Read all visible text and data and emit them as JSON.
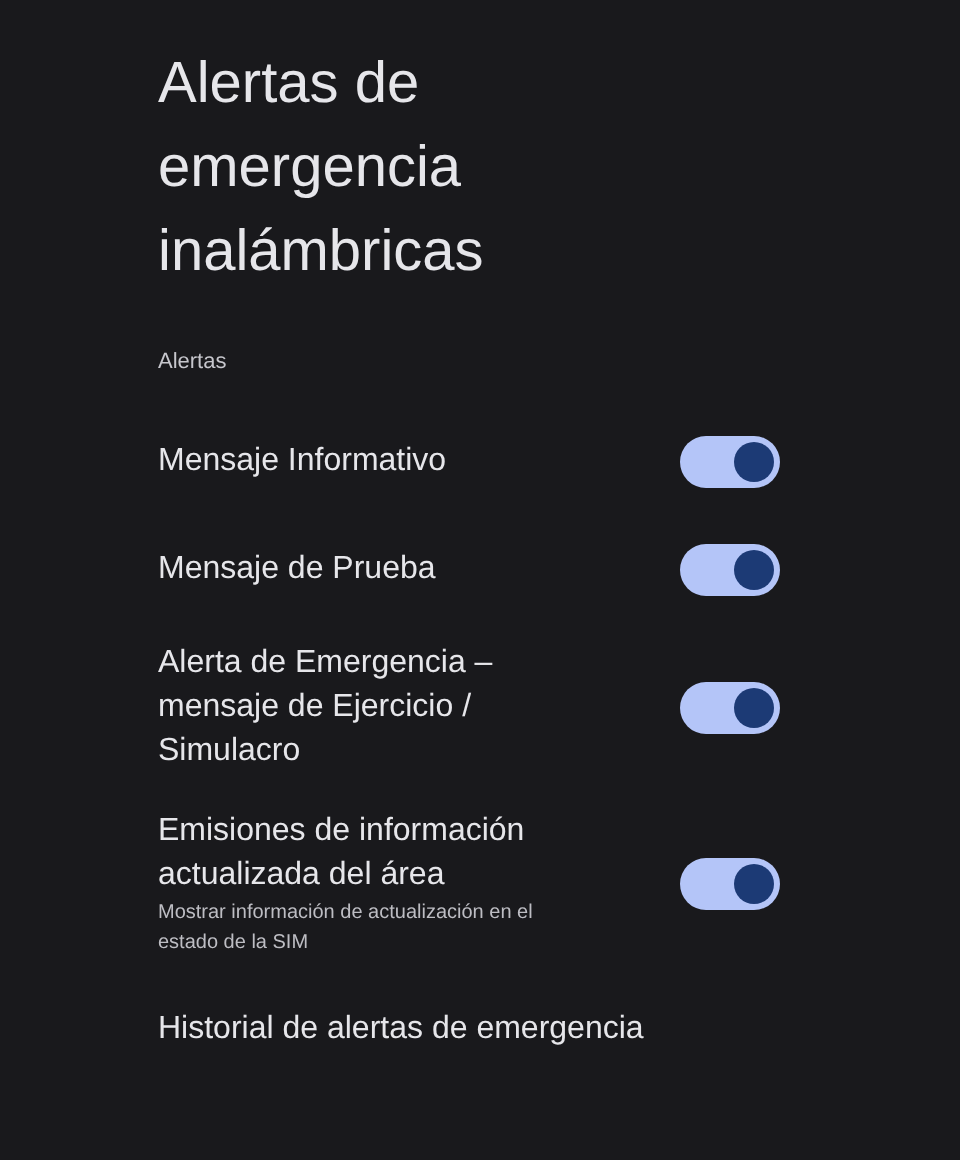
{
  "title": "Alertas de emergencia inalámbricas",
  "section": {
    "header": "Alertas",
    "items": [
      {
        "kind": "toggle",
        "label": "Mensaje Informativo",
        "on": true
      },
      {
        "kind": "toggle",
        "label": "Mensaje de Prueba",
        "on": true
      },
      {
        "kind": "toggle",
        "label": "Alerta de Emergencia – mensaje de Ejercicio / Simulacro",
        "on": true
      },
      {
        "kind": "toggle",
        "label": "Emisiones de información actualizada del área",
        "summary": "Mostrar información de actualización en el estado de la SIM",
        "on": true
      },
      {
        "kind": "link",
        "label": "Historial de alertas de emergencia"
      }
    ]
  }
}
